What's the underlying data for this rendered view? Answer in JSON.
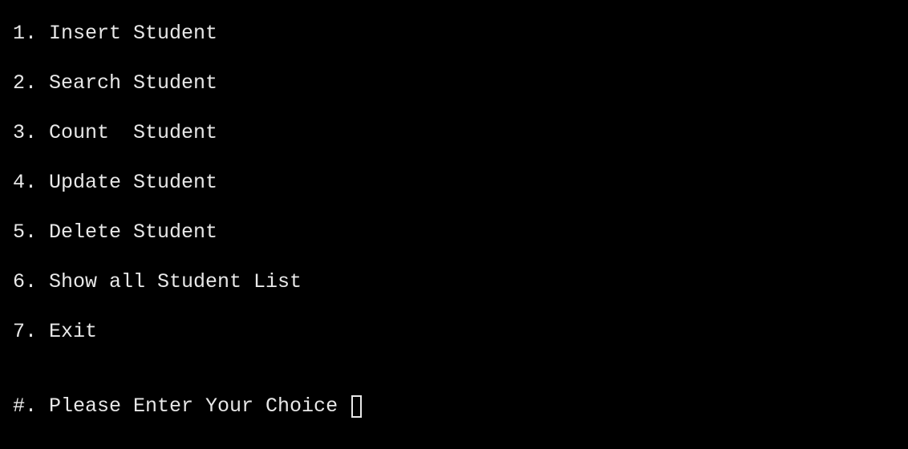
{
  "menu": {
    "items": [
      {
        "label": "1. Insert Student"
      },
      {
        "label": "2. Search Student"
      },
      {
        "label": "3. Count  Student"
      },
      {
        "label": "4. Update Student"
      },
      {
        "label": "5. Delete Student"
      },
      {
        "label": "6. Show all Student List"
      },
      {
        "label": "7. Exit"
      }
    ]
  },
  "prompt": {
    "text": "#. Please Enter Your Choice "
  },
  "colors": {
    "background": "#000000",
    "text": "#e8e8e8"
  }
}
